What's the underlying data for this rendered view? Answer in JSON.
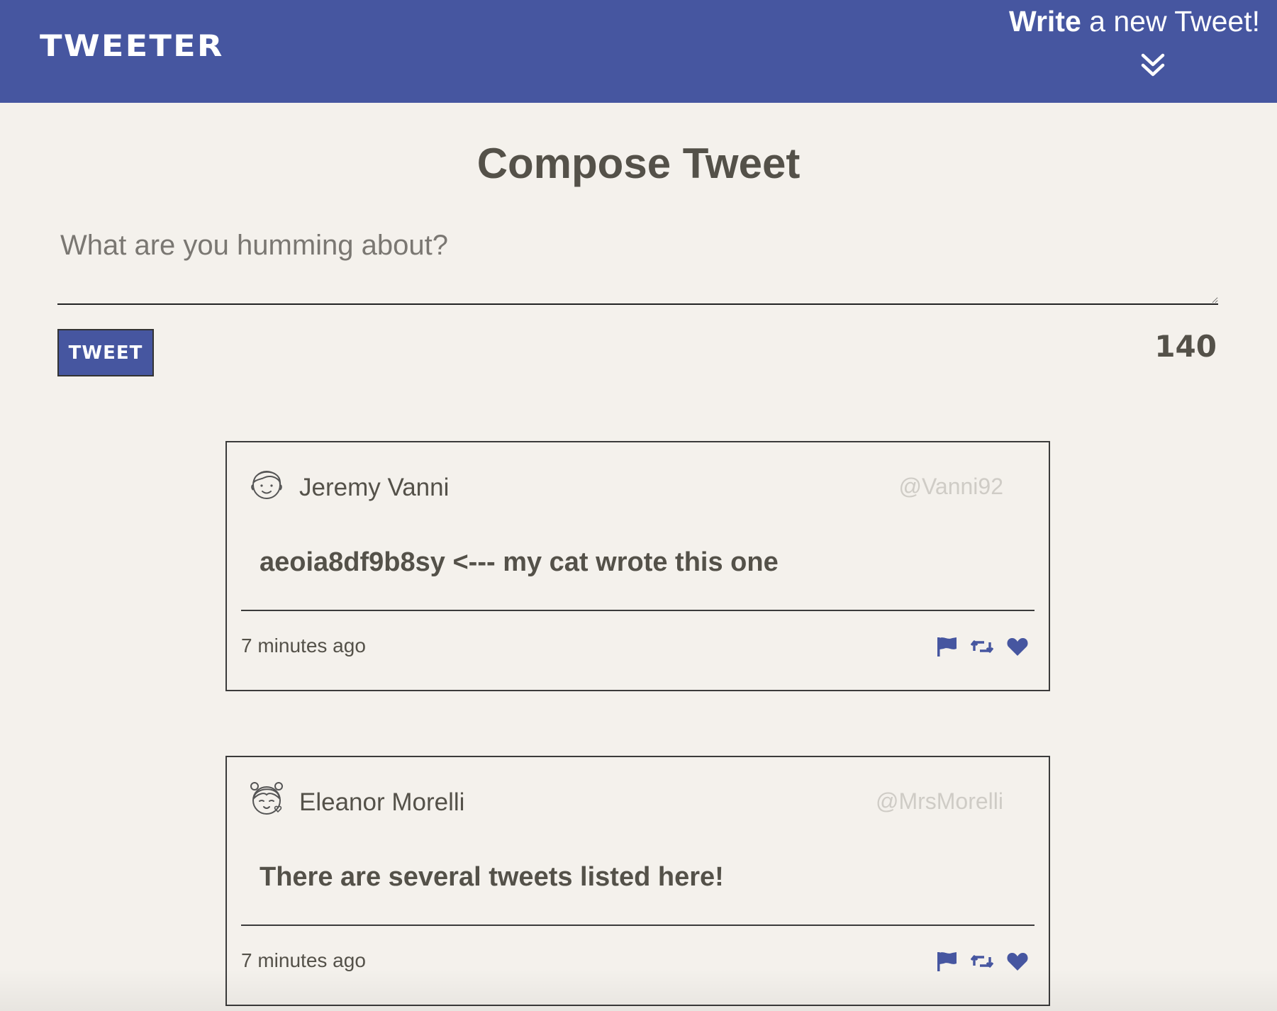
{
  "nav": {
    "brand": "TWEETER",
    "compose_toggle": {
      "bold_text": "Write",
      "rest_text": " a new Tweet!",
      "icon": "double-chevron-down-icon"
    }
  },
  "compose": {
    "title": "Compose Tweet",
    "placeholder": "What are you humming about?",
    "value": "",
    "button_label": "TWEET",
    "counter": "140"
  },
  "colors": {
    "brand": "#4656a0",
    "background": "#f4f1ec",
    "text": "#545149",
    "handle": "#cfccc6"
  },
  "tweets": [
    {
      "name": "Jeremy Vanni",
      "handle": "@Vanni92",
      "avatar_icon": "boy-avatar-icon",
      "content": "aeoia8df9b8sy <--- my cat wrote this one",
      "time": "7 minutes ago",
      "actions": [
        "flag-icon",
        "retweet-icon",
        "heart-icon"
      ]
    },
    {
      "name": "Eleanor Morelli",
      "handle": "@MrsMorelli",
      "avatar_icon": "girl-avatar-icon",
      "content": "There are several tweets listed here!",
      "time": "7 minutes ago",
      "actions": [
        "flag-icon",
        "retweet-icon",
        "heart-icon"
      ]
    }
  ]
}
